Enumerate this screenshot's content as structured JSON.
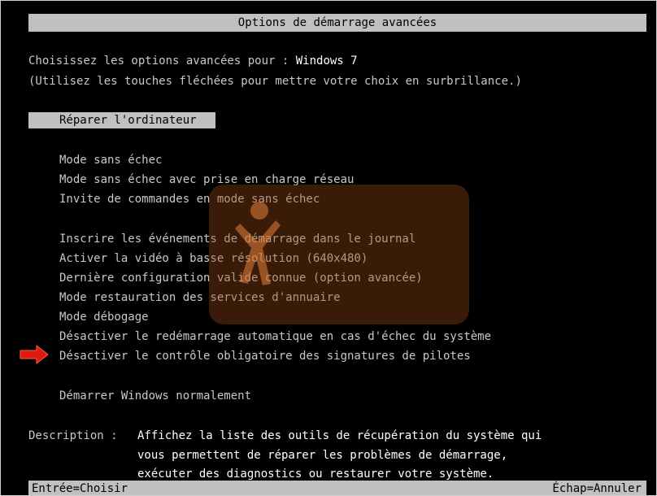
{
  "header": {
    "title": "Options de démarrage avancées"
  },
  "intro": {
    "line1_prefix": "Choisissez les options avancées pour : ",
    "os_name": "Windows 7",
    "line2": "(Utilisez les touches fléchées pour mettre votre choix en surbrillance.)"
  },
  "menu": {
    "selected": "Réparer l'ordinateur",
    "group1": [
      "Mode sans échec",
      "Mode sans échec avec prise en charge réseau",
      "Invite de commandes en mode sans échec"
    ],
    "group2": [
      "Inscrire les événements de démarrage dans le journal",
      "Activer la vidéo à basse résolution (640x480)",
      "Dernière configuration valide connue (option avancée)",
      "Mode restauration des services d'annuaire",
      "Mode débogage",
      "Désactiver le redémarrage automatique en cas d'échec du système",
      "Désactiver le contrôle obligatoire des signatures de pilotes"
    ],
    "group3": [
      "Démarrer Windows normalement"
    ]
  },
  "description": {
    "label": "Description : ",
    "lines": [
      "Affichez la liste des outils de récupération du système qui",
      "vous permettent de réparer les problèmes de démarrage,",
      "exécuter des diagnostics ou restaurer votre système."
    ]
  },
  "footer": {
    "left": "Entrée=Choisir",
    "right": "Échap=Annuler"
  },
  "colors": {
    "background": "#000000",
    "bar": "#c0c0c0",
    "text": "#c8c8c8",
    "arrow": "#e0190f"
  },
  "icons": {
    "pointer": "red-arrow-icon"
  }
}
